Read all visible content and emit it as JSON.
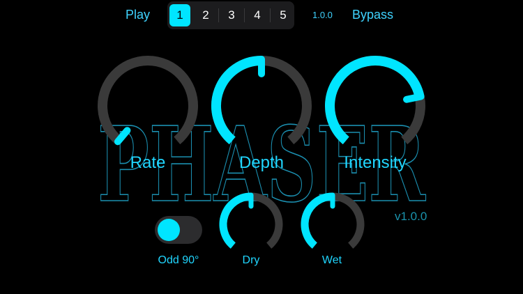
{
  "header": {
    "play_label": "Play",
    "presets": [
      "1",
      "2",
      "3",
      "4",
      "5"
    ],
    "selected_preset": "1",
    "version": "1.0.0",
    "bypass_label": "Bypass"
  },
  "logo": {
    "text": "PHASER",
    "version": "v1.0.0"
  },
  "knobs": {
    "rate": {
      "label": "Rate",
      "value": 0.0
    },
    "depth": {
      "label": "Depth",
      "value": 0.5
    },
    "intensity": {
      "label": "Intensity",
      "value": 0.78
    },
    "dry": {
      "label": "Dry",
      "value": 0.5
    },
    "wet": {
      "label": "Wet",
      "value": 0.5
    }
  },
  "toggle": {
    "label": "Odd 90°",
    "on": true
  },
  "colors": {
    "background": "#000000",
    "accent": "#00e5ff",
    "track": "#3a3a3a",
    "link": "#3fd3ff",
    "logo_stroke": "#1b8fb0"
  }
}
